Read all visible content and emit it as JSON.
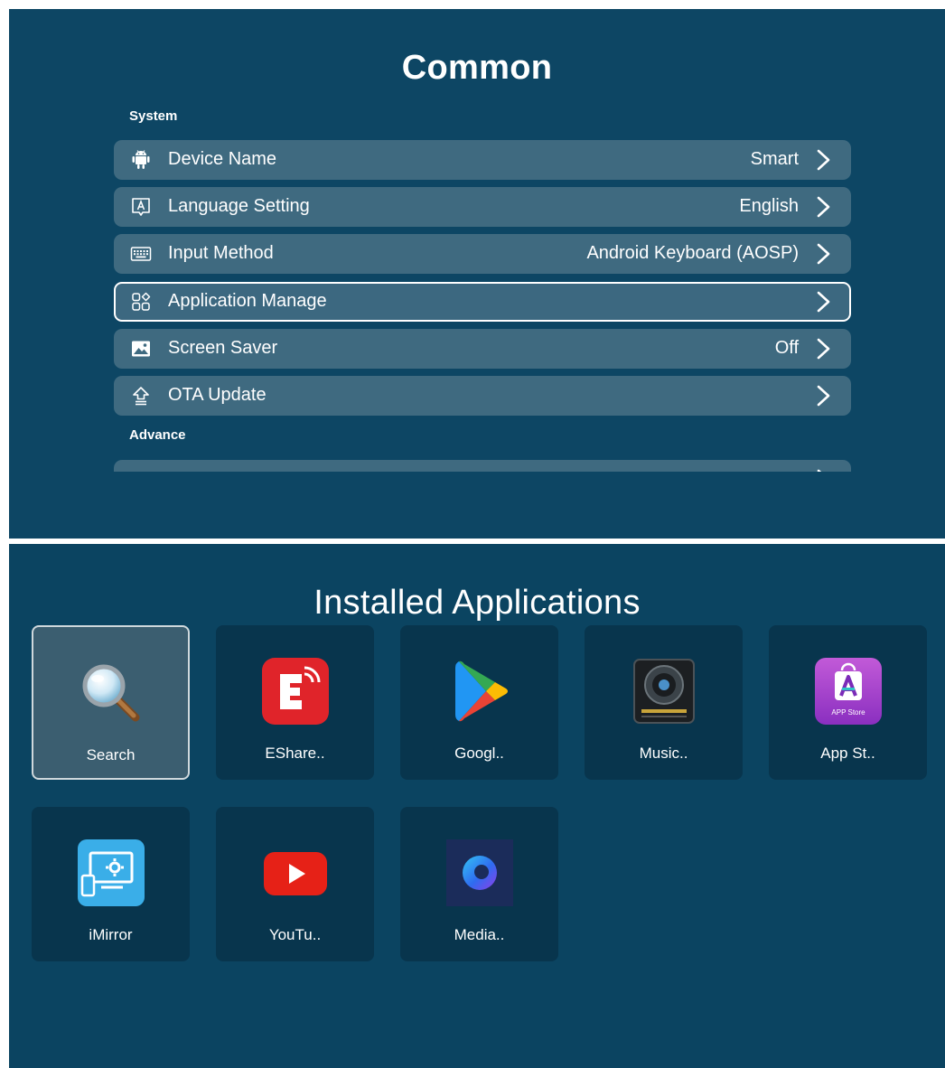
{
  "settings": {
    "title": "Common",
    "sections": {
      "system": "System",
      "advance": "Advance"
    },
    "rows": [
      {
        "label": "Device Name",
        "value": "Smart",
        "icon": "android-icon"
      },
      {
        "label": "Language Setting",
        "value": "English",
        "icon": "language-icon"
      },
      {
        "label": "Input Method",
        "value": "Android Keyboard (AOSP)",
        "icon": "keyboard-icon"
      },
      {
        "label": "Application Manage",
        "value": "",
        "icon": "apps-grid-icon"
      },
      {
        "label": "Screen Saver",
        "value": "Off",
        "icon": "image-icon"
      },
      {
        "label": "OTA Update",
        "value": "",
        "icon": "update-icon"
      }
    ]
  },
  "apps": {
    "title": "Installed Applications",
    "items": [
      {
        "name": "Search",
        "icon": "magnifier-icon"
      },
      {
        "name": "EShare..",
        "icon": "eshare-icon"
      },
      {
        "name": "Googl..",
        "icon": "google-play-icon"
      },
      {
        "name": "Music..",
        "icon": "music-speaker-icon"
      },
      {
        "name": "App St..",
        "icon": "app-store-icon"
      },
      {
        "name": "iMirror",
        "icon": "imirror-icon"
      },
      {
        "name": "YouTu..",
        "icon": "youtube-icon"
      },
      {
        "name": "Media..",
        "icon": "media-icon"
      }
    ],
    "app_store_badge": "APP Store"
  },
  "colors": {
    "background": "#0d4664",
    "row": "#3f6a80",
    "tile": "#08354d",
    "tile_focused": "#3b5e70"
  }
}
